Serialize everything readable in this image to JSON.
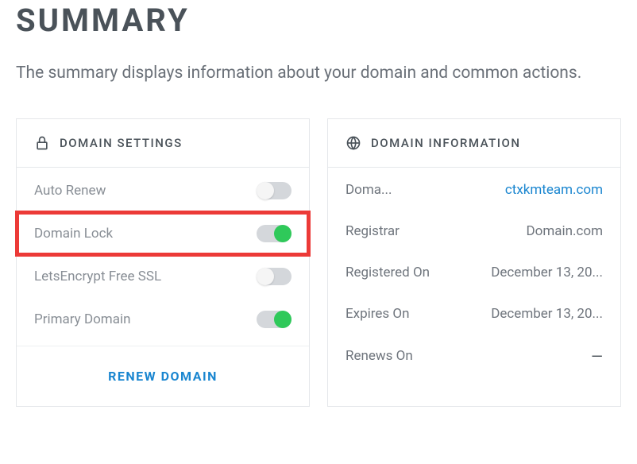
{
  "header": {
    "title": "SUMMARY",
    "description": "The summary displays information about your domain and common actions."
  },
  "settings": {
    "title": "DOMAIN SETTINGS",
    "items": [
      {
        "label": "Auto Renew",
        "on": false,
        "highlighted": false
      },
      {
        "label": "Domain Lock",
        "on": true,
        "highlighted": true
      },
      {
        "label": "LetsEncrypt Free SSL",
        "on": false,
        "highlighted": false
      },
      {
        "label": "Primary Domain",
        "on": true,
        "highlighted": false
      }
    ],
    "renew_label": "RENEW DOMAIN"
  },
  "info": {
    "title": "DOMAIN INFORMATION",
    "rows": [
      {
        "label": "Doma...",
        "value": "ctxkmteam.com",
        "link": true
      },
      {
        "label": "Registrar",
        "value": "Domain.com",
        "link": false
      },
      {
        "label": "Registered On",
        "value": "December 13, 20...",
        "link": false
      },
      {
        "label": "Expires On",
        "value": "December 13, 20...",
        "link": false
      },
      {
        "label": "Renews On",
        "value": "—",
        "link": false,
        "dash": true
      }
    ]
  }
}
